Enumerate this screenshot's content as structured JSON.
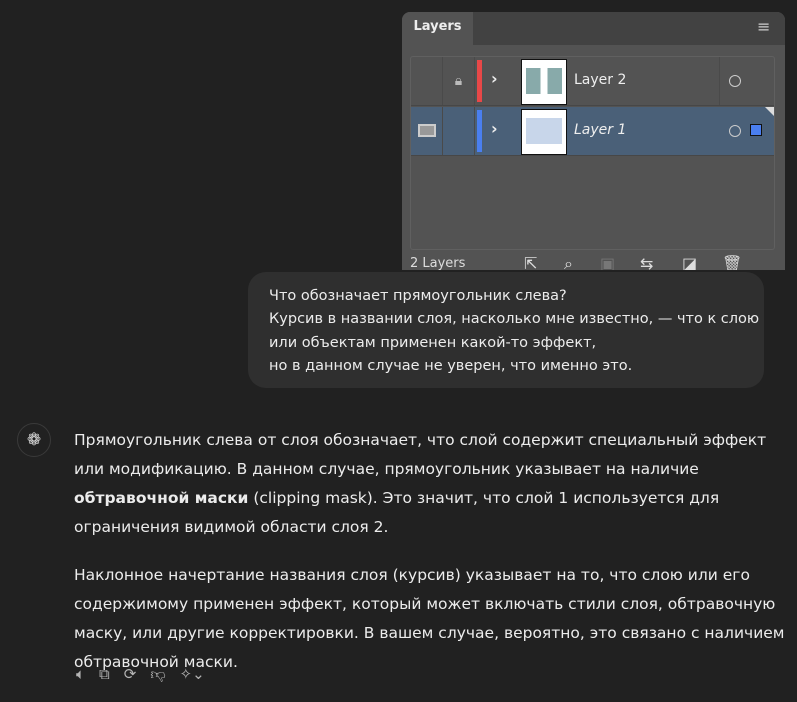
{
  "layers_panel": {
    "tab": "Layers",
    "count": "2 Layers",
    "layers": [
      {
        "name": "Layer 2",
        "color": "#e84848",
        "locked": true,
        "italic": false,
        "selected": false
      },
      {
        "name": "Layer 1",
        "color": "#4a7ff0",
        "locked": false,
        "italic": true,
        "selected": true
      }
    ]
  },
  "user_message": {
    "lines": [
      "Что обозначает прямоугольник слева?",
      "Курсив в названии слоя, насколько мне известно, — что к слою",
      "или объектам применен какой-то эффект,",
      "но в данном случае не уверен, что именно это."
    ]
  },
  "assistant": {
    "p1_a": "Прямоугольник слева от слоя обозначает, что слой содержит специальный эффект или модификацию. В данном случае, прямоугольник указывает на наличие ",
    "p1_bold": "обтравочной маски",
    "p1_b": " (clipping mask). Это значит, что слой 1 используется для ограничения видимой области слоя 2.",
    "p2": "Наклонное начертание названия слоя (курсив) указывает на то, что слою или его содержимому применен эффект, который может включать стили слоя, обтравочную маску, или другие корректировки. В вашем случае, вероятно, это связано с наличием обтравочной маски."
  },
  "icons": [
    "speaker-icon",
    "copy-icon",
    "regenerate-icon",
    "thumbs-down-icon",
    "sparkle-icon"
  ]
}
